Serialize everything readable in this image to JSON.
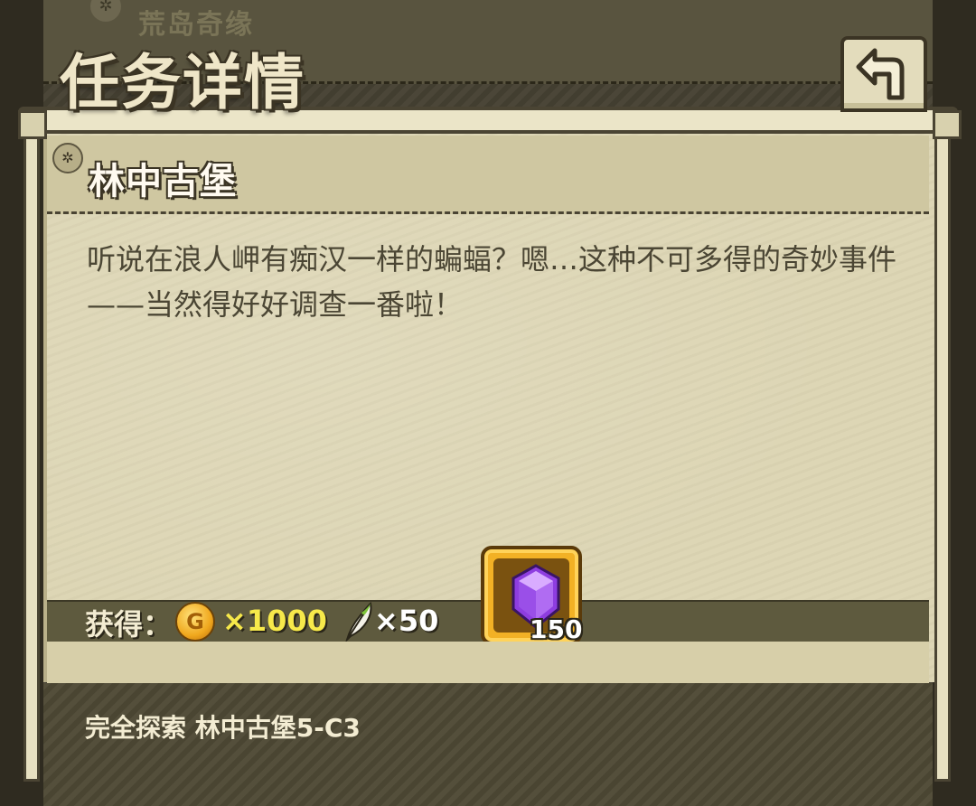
{
  "background_tab": {
    "icon": "seal-icon",
    "title": "荒岛奇缘"
  },
  "header": {
    "title": "任务详情",
    "back_icon": "back-arrow-icon"
  },
  "quest": {
    "icon": "seal-icon",
    "name": "林中古堡",
    "description": "听说在浪人岬有痴汉一样的蝙蝠？嗯…这种不可多得的奇妙事件——当然得好好调查一番啦！"
  },
  "rewards": {
    "label": "获得：",
    "coin": {
      "icon": "coin-icon",
      "symbol": "G",
      "amount": "×1000"
    },
    "feather": {
      "icon": "feather-icon",
      "amount": "×50"
    },
    "gem": {
      "icon": "purple-gem-icon",
      "count": "150"
    }
  },
  "objective": "完全探索 林中古堡5-C3",
  "colors": {
    "frame": "#454032",
    "parchment": "#ddd6b5",
    "coin_text": "#f7e94a",
    "gem_tile": "#f2b125"
  }
}
